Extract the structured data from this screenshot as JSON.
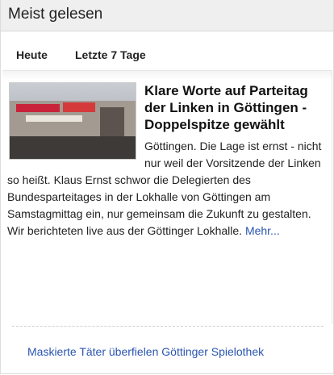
{
  "widget": {
    "title": "Meist gelesen",
    "tabs": [
      {
        "label": "Heute"
      },
      {
        "label": "Letzte 7 Tage"
      }
    ]
  },
  "featured": {
    "image_icon": "news-photo",
    "headline": "Klare Worte auf Parteitag der Linken in Göttingen - Doppelspitze gewählt",
    "body": "Göttingen. Die Lage ist ernst - nicht nur weil der Vorsitzende der Linken so heißt. Klaus Ernst schwor die Delegierten des Bundesparteitages in der Lokhalle von Göttingen am Samstagmittag ein, nur gemeinsam die Zukunft zu gestalten. Wir berichteten live aus der Göttinger Lokhalle.",
    "more_label": "Mehr..."
  },
  "list": [
    {
      "title": "Maskierte Täter überfielen Göttinger Spielothek"
    }
  ],
  "colors": {
    "link": "#2a55b0",
    "title_bar": "#efefef"
  }
}
